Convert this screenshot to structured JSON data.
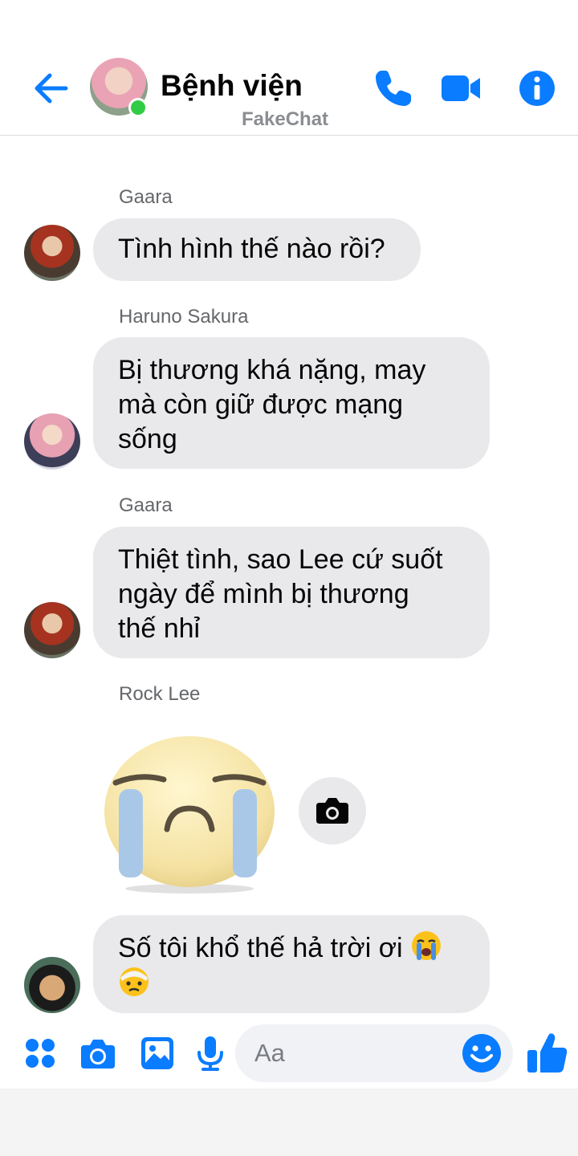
{
  "header": {
    "title": "Bệnh viện",
    "watermark": "FakeChat"
  },
  "colors": {
    "accent": "#0a7cff",
    "online": "#31cc46",
    "bubble": "#e9e9eb"
  },
  "messages": [
    {
      "sender": "Gaara",
      "text": "Tình hình thế nào rồi?"
    },
    {
      "sender": "Haruno Sakura",
      "lines": [
        "Bị thương khá nặng, may",
        "mà còn giữ được mạng",
        "sống"
      ]
    },
    {
      "sender": "Gaara",
      "lines": [
        "Thiệt tình, sao Lee cứ suốt",
        "ngày để mình bị thương",
        "thế nhỉ"
      ]
    },
    {
      "sender": "Rock Lee",
      "sticker": "crying-face-sticker"
    },
    {
      "sender": "Rock Lee",
      "text": "Số tôi khổ thế hả trời ơi",
      "emojis": [
        "loudly-crying-face",
        "face-with-head-bandage"
      ]
    }
  ],
  "composer": {
    "placeholder": "Aa"
  },
  "icons": [
    "back-arrow-icon",
    "phone-icon",
    "video-camera-icon",
    "info-icon",
    "apps-icon",
    "camera-icon",
    "gallery-icon",
    "microphone-icon",
    "smiley-icon",
    "thumbs-up-icon"
  ]
}
